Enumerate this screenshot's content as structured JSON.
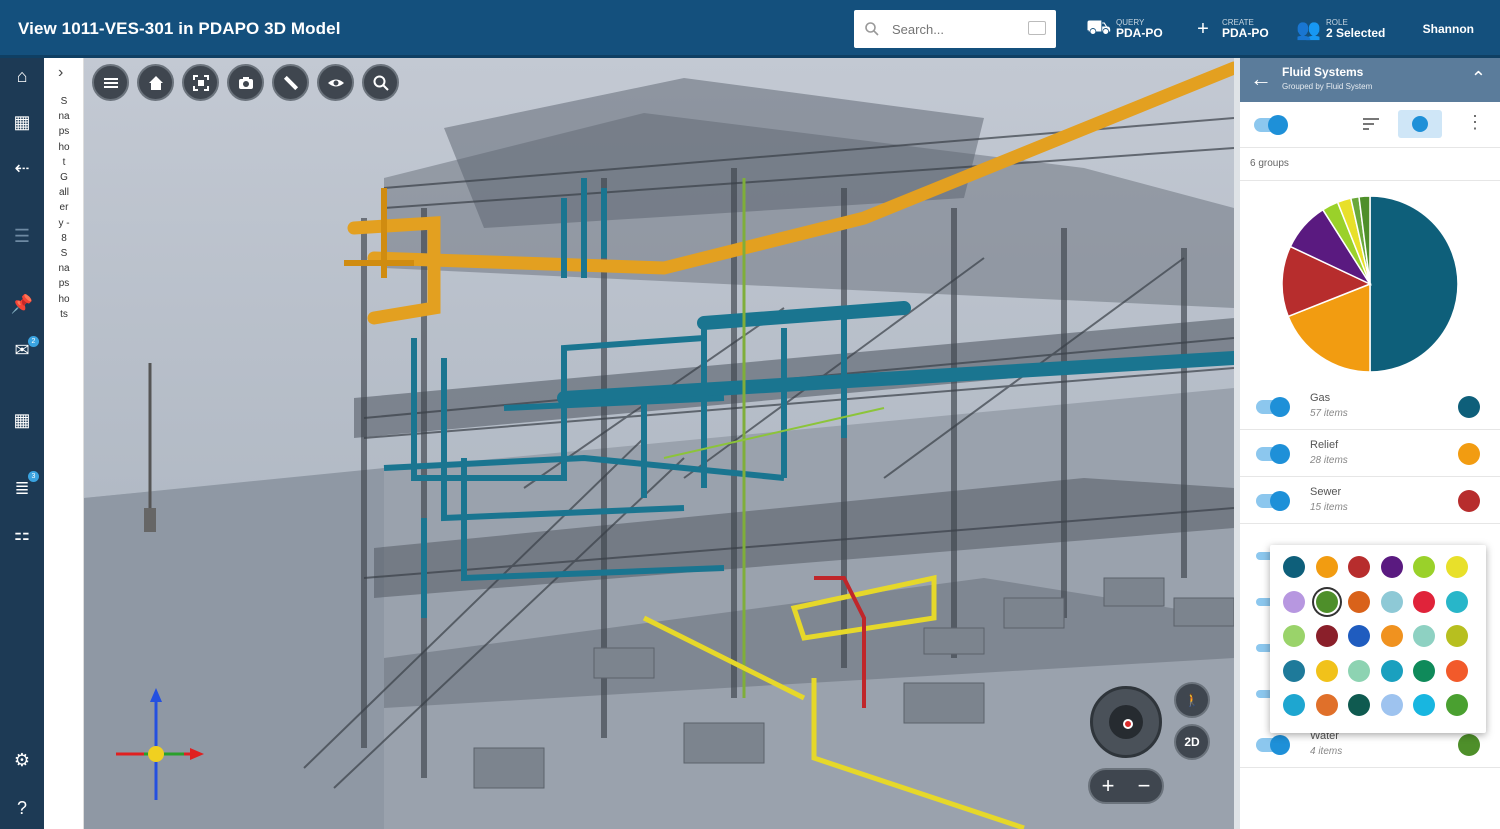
{
  "header": {
    "title": "View 1011-VES-301 in PDAPO 3D Model",
    "search_placeholder": "Search...",
    "query": {
      "small": "QUERY",
      "big": "PDA-PO"
    },
    "create": {
      "small": "CREATE",
      "big": "PDA-PO"
    },
    "role": {
      "small": "ROLE",
      "big": "2 Selected"
    },
    "user": "Shannon"
  },
  "left_rail": {
    "items": [
      "home-icon",
      "dashboard-icon",
      "back-arrow-icon",
      "list-icon",
      "pin-icon",
      "inbox-icon",
      "apps-icon",
      "tasks-icon",
      "org-icon"
    ],
    "badges": {
      "inbox": "2",
      "tasks": "3"
    }
  },
  "snapshot_strip": {
    "text": "Snapshot Gallery - 8 Snapshots"
  },
  "viewport": {
    "toolbar": [
      "menu",
      "home",
      "fit",
      "camera",
      "measure",
      "visibility",
      "zoom-box"
    ],
    "view_2d_label": "2D",
    "zoom_in": "+",
    "zoom_out": "−"
  },
  "panel": {
    "title": "Fluid Systems",
    "subtitle": "Grouped by Fluid System",
    "groups_label": "6 groups",
    "groups": [
      {
        "name": "Gas",
        "count": "57 items",
        "color": "#0e5f7a"
      },
      {
        "name": "Relief",
        "count": "28 items",
        "color": "#f29c11"
      },
      {
        "name": "Sewer",
        "count": "15 items",
        "color": "#b72d2d"
      }
    ],
    "last_group": {
      "name": "Water",
      "count": "4 items",
      "color": "#4e8f2a"
    }
  },
  "chart_data": {
    "type": "pie",
    "title": "",
    "slices": [
      {
        "label": "Gas",
        "value": 50,
        "color": "#0e5f7a"
      },
      {
        "label": "Relief",
        "value": 19,
        "color": "#f29c11"
      },
      {
        "label": "Sewer",
        "value": 13,
        "color": "#b72d2d"
      },
      {
        "label": "",
        "value": 9,
        "color": "#5a1a80"
      },
      {
        "label": "",
        "value": 3,
        "color": "#9ad12a"
      },
      {
        "label": "",
        "value": 2.5,
        "color": "#e8e02a"
      },
      {
        "label": "",
        "value": 1.5,
        "color": "#6aa83a"
      },
      {
        "label": "Water",
        "value": 2,
        "color": "#4e8f2a"
      }
    ]
  },
  "palette": {
    "colors": [
      "#0e5f7a",
      "#f29c11",
      "#b72d2d",
      "#5a1a80",
      "#9ad12a",
      "#e8e02a",
      "#b797e0",
      "#4e8f2a",
      "#d9621a",
      "#8ec9d6",
      "#e0233a",
      "#28b6c9",
      "#9ad36a",
      "#8a1f2a",
      "#1f5cbf",
      "#f0921f",
      "#8ed1c2",
      "#b7bf1f",
      "#1e7a9a",
      "#f1c21a",
      "#8dd3b2",
      "#1aa0bf",
      "#0f8a5a",
      "#f25a2a",
      "#1ea6d0",
      "#e0702a",
      "#0f5a50",
      "#9ec3ef",
      "#18b6e0",
      "#4aa030"
    ],
    "selected_index": 7
  }
}
